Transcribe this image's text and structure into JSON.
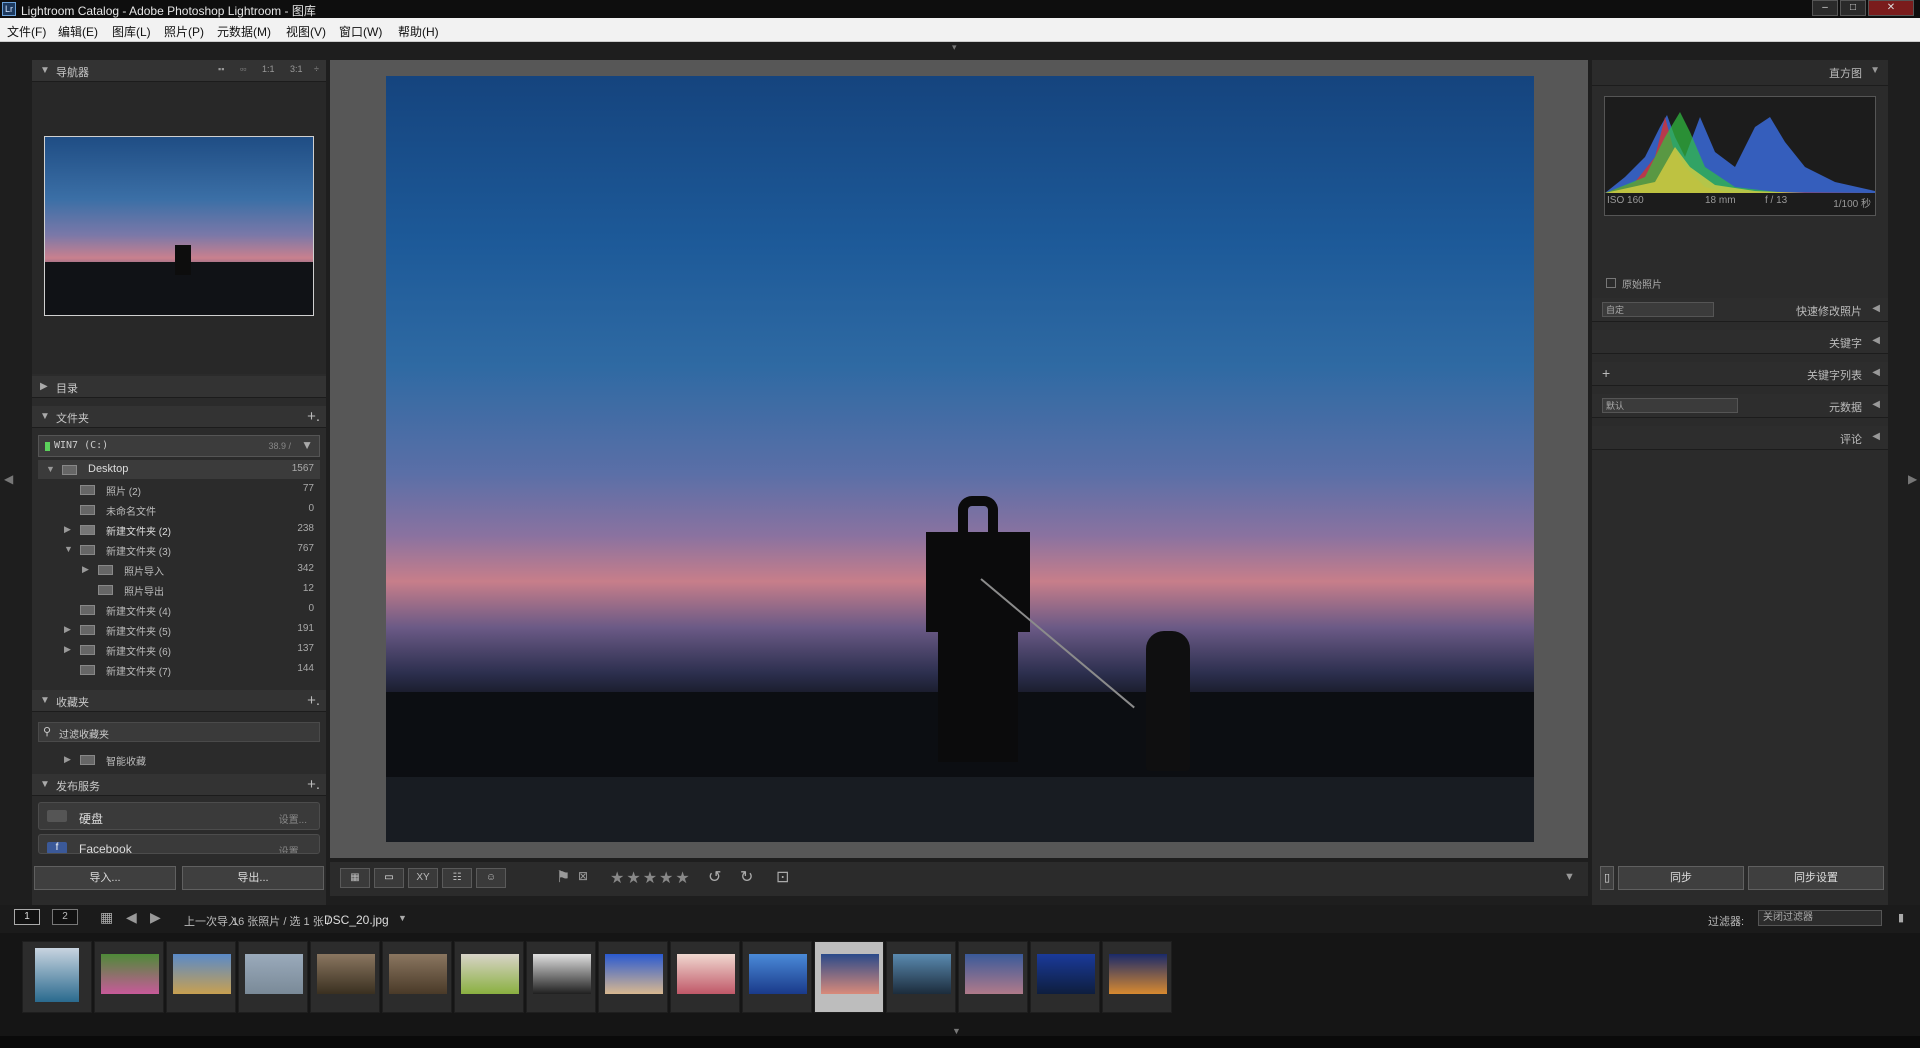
{
  "window": {
    "app_icon": "Lr",
    "title": "Lightroom Catalog - Adobe Photoshop Lightroom - 图库",
    "controls": {
      "minimize": "–",
      "maximize": "□",
      "close": "✕"
    }
  },
  "menu": [
    "文件(F)",
    "编辑(E)",
    "图库(L)",
    "照片(P)",
    "元数据(M)",
    "视图(V)",
    "窗口(W)",
    "帮助(H)"
  ],
  "left_panel": {
    "navigator": {
      "title": "导航器",
      "sizes": [
        "▪▪",
        "▫▫",
        "1:1",
        "3:1",
        "÷"
      ]
    },
    "catalog": {
      "title": "目录"
    },
    "folders": {
      "title": "文件夹",
      "plus": "+.",
      "volume": {
        "name": "WIN7 (C:)",
        "size": "38.9 /",
        "arrow": "▼"
      },
      "rows": [
        {
          "name": "Desktop",
          "count": "1567",
          "tri": "▼"
        },
        {
          "name": "照片 (2)",
          "count": "77",
          "tri": ""
        },
        {
          "name": "未命名文件",
          "count": "0",
          "tri": ""
        },
        {
          "name": "新建文件夹 (2)",
          "count": "238",
          "tri": "▶"
        },
        {
          "name": "新建文件夹 (3)",
          "count": "767",
          "tri": "▼"
        },
        {
          "name": "照片导入",
          "count": "342",
          "tri": "▶"
        },
        {
          "name": "照片导出",
          "count": "12",
          "tri": ""
        },
        {
          "name": "新建文件夹 (4)",
          "count": "0",
          "tri": ""
        },
        {
          "name": "新建文件夹 (5)",
          "count": "191",
          "tri": "▶"
        },
        {
          "name": "新建文件夹 (6)",
          "count": "137",
          "tri": "▶"
        },
        {
          "name": "新建文件夹 (7)",
          "count": "144",
          "tri": ""
        }
      ]
    },
    "collections": {
      "title": "收藏夹",
      "plus": "+.",
      "search_placeholder": "过滤收藏夹",
      "set_label": "智能收藏"
    },
    "publish": {
      "title": "发布服务",
      "plus": "+.",
      "services": [
        {
          "name": "硬盘",
          "setting": "设置...",
          "icon": "hd-icon"
        },
        {
          "name": "Facebook",
          "setting": "设置...",
          "icon": "facebook-icon"
        }
      ]
    },
    "buttons": {
      "import": "导入...",
      "export": "导出..."
    }
  },
  "toolbar": {
    "stars": "★★★★★",
    "view_icons": [
      "grid-view-icon",
      "loupe-view-icon",
      "compare-view-icon",
      "survey-view-icon",
      "people-view-icon"
    ],
    "compare_label": "XY"
  },
  "right_panel": {
    "histogram": {
      "title": "直方图",
      "iso": "ISO 160",
      "focal": "18 mm",
      "aperture": "f / 13",
      "shutter": "1/100 秒",
      "original_label": "原始照片"
    },
    "quick_develop": {
      "preset": "自定",
      "title": "快速修改照片"
    },
    "keywords": {
      "title": "关键字"
    },
    "keyword_list": {
      "title": "关键字列表",
      "plus": "+"
    },
    "metadata": {
      "preset": "默认",
      "title": "元数据"
    },
    "comments": {
      "title": "评论"
    },
    "buttons": {
      "sync": "同步",
      "sync_settings": "同步设置"
    }
  },
  "filmstrip_bar": {
    "pages": [
      "1",
      "2"
    ],
    "source": "上一次导入",
    "count": "16 张照片 / 选 1 张 /",
    "filename": "DSC_20.jpg",
    "filter_label": "过滤器:",
    "filter_value": "关闭过滤器"
  },
  "filmstrip": [
    {
      "colors": [
        "#c8d4e0",
        "#2a6a8e"
      ],
      "active": false
    },
    {
      "colors": [
        "#4e8a38",
        "#c85a9a"
      ],
      "active": false
    },
    {
      "colors": [
        "#5a8ac8",
        "#c8a050"
      ],
      "active": false
    },
    {
      "colors": [
        "#9aaabb",
        "#7a8a98"
      ],
      "active": false
    },
    {
      "colors": [
        "#8a7660",
        "#3a3020"
      ],
      "active": false
    },
    {
      "colors": [
        "#8a7660",
        "#4a3a28"
      ],
      "active": false
    },
    {
      "colors": [
        "#d8d4c8",
        "#8ab040"
      ],
      "active": false
    },
    {
      "colors": [
        "#e0e0e0",
        "#202020"
      ],
      "active": false
    },
    {
      "colors": [
        "#2a5ad0",
        "#d8b890"
      ],
      "active": false
    },
    {
      "colors": [
        "#f0d8d0",
        "#c05868"
      ],
      "active": false
    },
    {
      "colors": [
        "#4a8ad8",
        "#1a3a8a"
      ],
      "active": false
    },
    {
      "colors": [
        "#2a4a8a",
        "#d88a7a"
      ],
      "active": true
    },
    {
      "colors": [
        "#5a8ab0",
        "#1c2c3c"
      ],
      "active": false
    },
    {
      "colors": [
        "#3a5a9a",
        "#b07a8a"
      ],
      "active": false
    },
    {
      "colors": [
        "#1a3a9a",
        "#0e1e3e"
      ],
      "active": false
    },
    {
      "colors": [
        "#1a2a6a",
        "#d88a30"
      ],
      "active": false
    }
  ]
}
